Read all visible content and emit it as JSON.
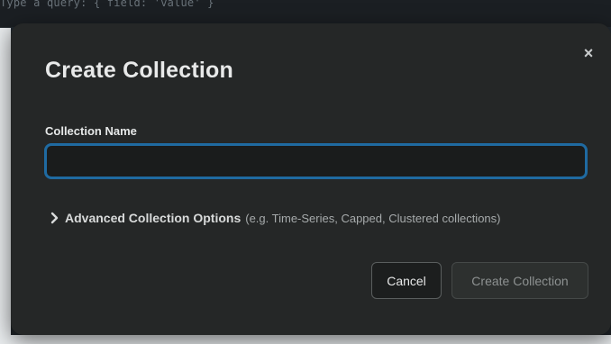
{
  "background": {
    "query_placeholder": "Type a query: { field: 'value' }",
    "bottom_text": "..."
  },
  "modal": {
    "title": "Create Collection",
    "close_label": "×",
    "field_label": "Collection Name",
    "name_input_value": "",
    "name_input_placeholder": "",
    "advanced_label": "Advanced Collection Options",
    "advanced_hint": "(e.g. Time-Series, Capped, Clustered collections)",
    "cancel_label": "Cancel",
    "create_label": "Create Collection"
  },
  "colors": {
    "modal_bg": "#252727",
    "input_focus_border": "#1f6aa1",
    "primary_disabled_text": "#8d9191"
  }
}
